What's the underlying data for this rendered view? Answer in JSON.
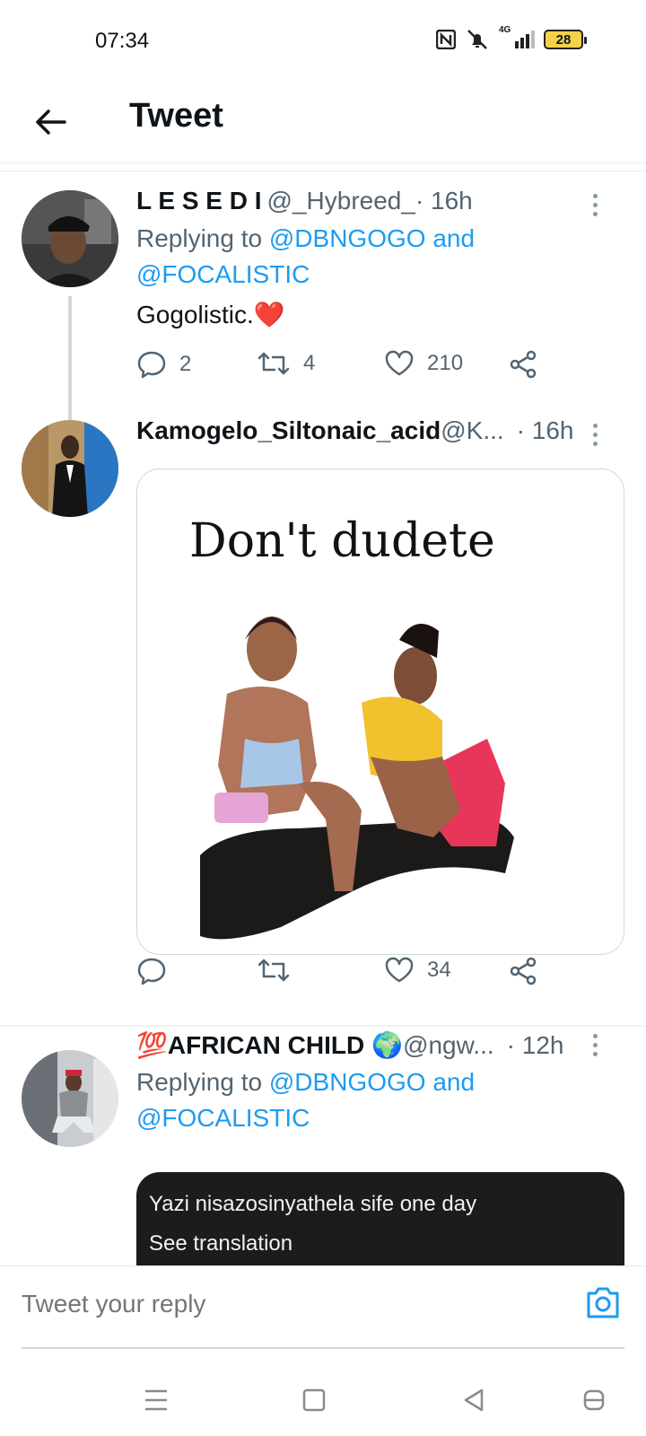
{
  "status_bar": {
    "time": "07:34",
    "network": "4G",
    "battery": "28"
  },
  "top_bar": {
    "title": "Tweet"
  },
  "tweets": [
    {
      "name": "L E S E D I",
      "handle": "@_Hybreed_",
      "time": " · 16h",
      "replying_prefix": "Replying to ",
      "replying_to_1": "@DBNGOGO",
      "replying_and": " and",
      "replying_to_2": "@FOCALISTIC",
      "text": "Gogolistic.",
      "emoji": "❤️",
      "replies": "2",
      "retweets": "4",
      "likes": "210"
    },
    {
      "name": "Kamogelo_Siltonaic_acid",
      "handle": " @K...",
      "time": " · 16h",
      "media_caption": "Don't dudete",
      "replies": "",
      "retweets": "",
      "likes": "34"
    },
    {
      "name_emoji": "💯",
      "name": "AFRICAN CHILD",
      "name_badge": "🌍",
      "handle": " @ngw...",
      "time": " · 12h",
      "replying_prefix": "Replying to ",
      "replying_to_1": "@DBNGOGO",
      "replying_and": " and",
      "replying_to_2": "@FOCALISTIC",
      "media_text": "Yazi nisazosinyathela sife one day",
      "media_translate": "See translation"
    }
  ],
  "reply_bar": {
    "placeholder": "Tweet your reply"
  },
  "colors": {
    "link": "#1d9bf0",
    "meta": "#536471",
    "text": "#0f1419"
  }
}
